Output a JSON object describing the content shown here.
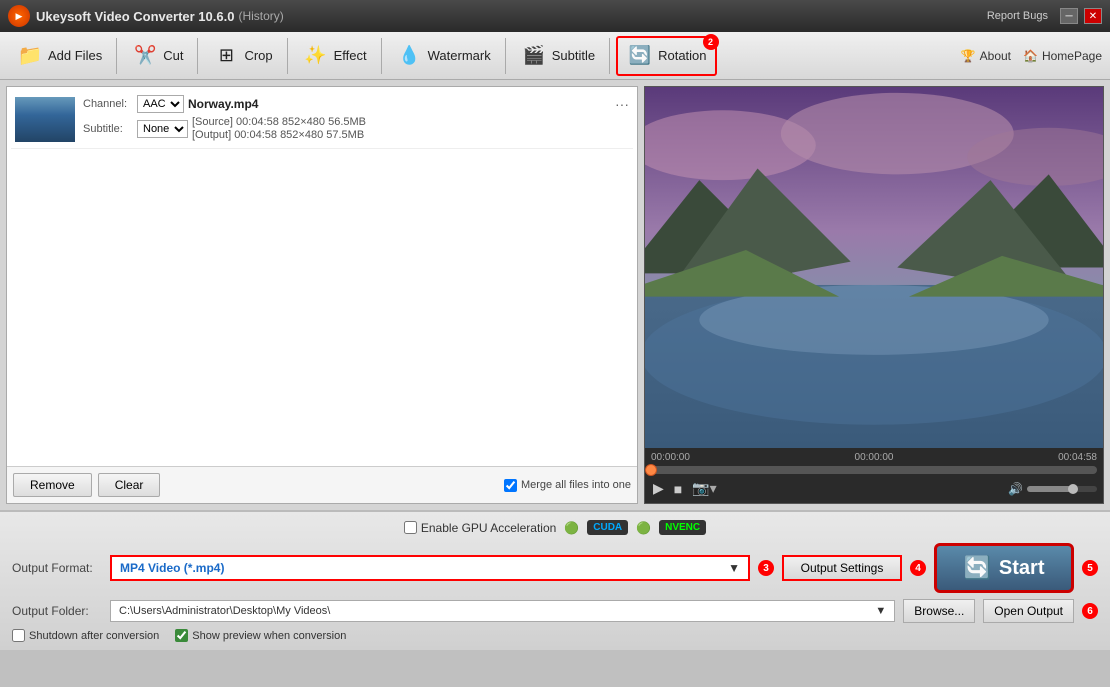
{
  "titleBar": {
    "appName": "Ukeysoft Video Converter 10.6.0",
    "history": "(History)",
    "reportBugs": "Report Bugs"
  },
  "toolbar": {
    "addFiles": "Add Files",
    "cut": "Cut",
    "crop": "Crop",
    "effect": "Effect",
    "watermark": "Watermark",
    "subtitle": "Subtitle",
    "rotation": "Rotation",
    "rotationBadge": "2",
    "about": "About",
    "homePage": "HomePage"
  },
  "filePanel": {
    "fileName": "Norway.mp4",
    "channelLabel": "Channel:",
    "channelValue": "AAC",
    "subtitleLabel": "Subtitle:",
    "subtitleValue": "None",
    "sourceInfo": "[Source]  00:04:58  852×480  56.5MB",
    "outputInfo": "[Output]  00:04:58  852×480  57.5MB",
    "removeBtn": "Remove",
    "clearBtn": "Clear",
    "mergeLabel": "Merge all files into one"
  },
  "preview": {
    "timeStart": "00:00:00",
    "timeMid": "00:00:00",
    "timeEnd": "00:04:58"
  },
  "bottomSection": {
    "gpuLabel": "Enable GPU Acceleration",
    "cudaBadge": "CUDA",
    "nvencBadge": "NVENC",
    "outputFormatLabel": "Output Format:",
    "outputFormatValue": "MP4 Video (*.mp4)",
    "outputFormatBadge": "3",
    "outputSettingsBtn": "Output Settings",
    "outputSettingsBadge": "4",
    "outputFolderLabel": "Output Folder:",
    "outputFolderPath": "C:\\Users\\Administrator\\Desktop\\My Videos\\",
    "browseBtn": "Browse...",
    "openOutputBtn": "Open Output",
    "openOutputBadge": "6",
    "shutdownLabel": "Shutdown after conversion",
    "showPreviewLabel": "Show preview when conversion",
    "startBtn": "Start",
    "startBadge": "5"
  }
}
